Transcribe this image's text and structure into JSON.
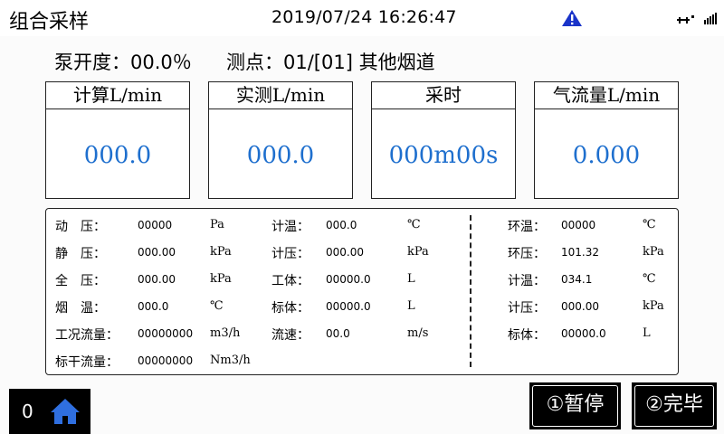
{
  "header": {
    "title": "组合采样",
    "datetime": "2019/07/24 16:26:47",
    "warning_icon": "warning-triangle-icon",
    "signal_icon": "signal-bars-icon"
  },
  "status": {
    "pump_label": "泵开度：00.0％",
    "point_label": "测点：01/[01] 其他烟道"
  },
  "cards": [
    {
      "title": "计算L/min",
      "value": "000.0"
    },
    {
      "title": "实测L/min",
      "value": "000.0"
    },
    {
      "title": "采时",
      "value": "000m00s"
    },
    {
      "title": "气流量L/min",
      "value": "0.000"
    }
  ],
  "readings": {
    "left": [
      {
        "label": "动　压：",
        "value": "00000",
        "unit": "Pa"
      },
      {
        "label": "静　压：",
        "value": "000.00",
        "unit": "kPa"
      },
      {
        "label": "全　压：",
        "value": "000.00",
        "unit": "kPa"
      },
      {
        "label": "烟　温：",
        "value": "000.0",
        "unit": "℃"
      },
      {
        "label": "工况流量：",
        "value": "00000000",
        "unit": "m3/h"
      },
      {
        "label": "标干流量：",
        "value": "00000000",
        "unit": "Nm3/h"
      }
    ],
    "middle": [
      {
        "label": "计温：",
        "value": "000.0",
        "unit": "℃"
      },
      {
        "label": "计压：",
        "value": "000.00",
        "unit": "kPa"
      },
      {
        "label": "工体：",
        "value": "00000.0",
        "unit": "L"
      },
      {
        "label": "标体：",
        "value": "00000.0",
        "unit": "L"
      },
      {
        "label": "流速：",
        "value": "00.0",
        "unit": "m/s"
      }
    ],
    "right": [
      {
        "label": "环温：",
        "value": "00000",
        "unit": "℃"
      },
      {
        "label": "环压：",
        "value": "101.32",
        "unit": "kPa"
      },
      {
        "label": "计温：",
        "value": "034.1",
        "unit": "℃"
      },
      {
        "label": "计压：",
        "value": "000.00",
        "unit": "kPa"
      },
      {
        "label": "标体：",
        "value": "00000.0",
        "unit": "L"
      }
    ]
  },
  "footer": {
    "counter": "0",
    "home_icon": "home-icon",
    "pause_label": "①暂停",
    "finish_label": "②完毕"
  },
  "colors": {
    "value_blue": "#1e6fce",
    "warning_blue": "#1a34c9",
    "home_blue": "#2f6fe0"
  }
}
